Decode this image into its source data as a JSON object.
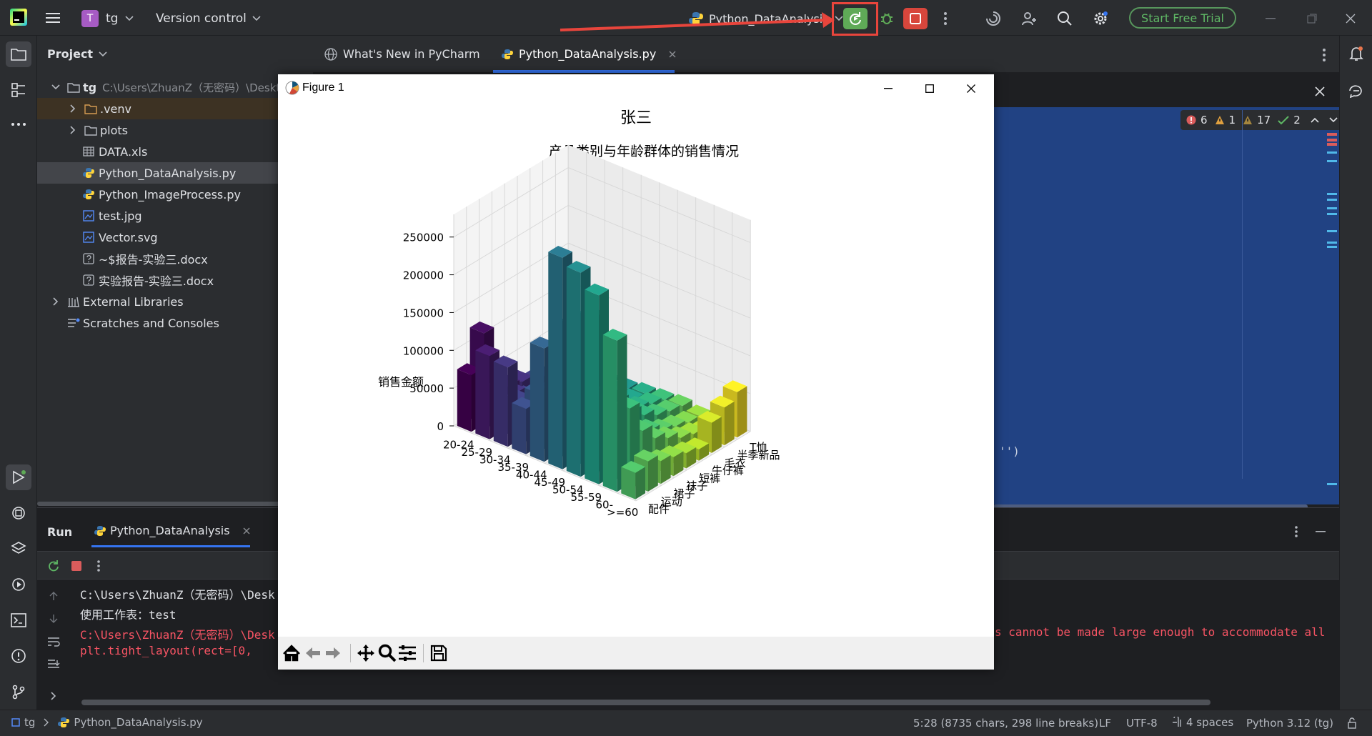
{
  "titlebar": {
    "project_badge": "T",
    "project_name": "tg",
    "vcs_label": "Version control",
    "run_config": "Python_DataAnalysis",
    "trial_button": "Start Free Trial"
  },
  "project_panel": {
    "title": "Project",
    "root_name": "tg",
    "root_path": "C:\\Users\\ZhuanZ（无密码）\\Deskto",
    "items": [
      {
        "label": ".venv",
        "icon": "folder-icon"
      },
      {
        "label": "plots",
        "icon": "folder-icon"
      },
      {
        "label": "DATA.xls",
        "icon": "table-file-icon"
      },
      {
        "label": "Python_DataAnalysis.py",
        "icon": "python-file-icon"
      },
      {
        "label": "Python_ImageProcess.py",
        "icon": "python-file-icon"
      },
      {
        "label": "test.jpg",
        "icon": "image-file-icon"
      },
      {
        "label": "Vector.svg",
        "icon": "image-file-icon"
      },
      {
        "label": "~$报告-实验三.docx",
        "icon": "unknown-file-icon"
      },
      {
        "label": "实验报告-实验三.docx",
        "icon": "unknown-file-icon"
      }
    ],
    "external_libraries": "External Libraries",
    "scratches": "Scratches and Consoles"
  },
  "editor": {
    "tabs": [
      {
        "label": "What's New in PyCharm"
      },
      {
        "label": "Python_DataAnalysis.py"
      }
    ],
    "inspections": {
      "errors": "6",
      "warnings": "1",
      "weak_warnings": "17",
      "typos": "2"
    },
    "code_fragment": "'')"
  },
  "run_panel": {
    "title": "Run",
    "tab_label": "Python_DataAnalysis",
    "lines": [
      "C:\\Users\\ZhuanZ（无密码）\\Desk",
      "使用工作表：test",
      "C:\\Users\\ZhuanZ（无密码）\\Desk",
      "  plt.tight_layout(rect=[0,"
    ],
    "warning_tail": "s cannot be made large enough to accommodate all"
  },
  "statusbar": {
    "breadcrumb_root": "tg",
    "breadcrumb_file": "Python_DataAnalysis.py",
    "position": "5:28 (8735 chars, 298 line breaks)",
    "line_ending": "LF",
    "encoding": "UTF-8",
    "indent": "4 spaces",
    "interpreter": "Python 3.12 (tg)"
  },
  "figure": {
    "window_title": "Figure 1"
  },
  "chart_data": {
    "type": "bar3d",
    "title": "张三",
    "subtitle": "产品类别与年龄群体的销售情况",
    "xlabel": "",
    "ylabel": "",
    "zlabel": "销售金额",
    "x_categories": [
      "20-24",
      "25-29",
      "30-34",
      "35-39",
      "40-44",
      "45-49",
      "50-54",
      "55-59",
      "60-",
      ">=60"
    ],
    "y_categories": [
      "配件",
      "运动",
      "裙子",
      "袜子",
      "短裤",
      "牛仔裤",
      "毛衣",
      "半季新品",
      "T恤"
    ],
    "z_ticks": [
      0,
      50000,
      100000,
      150000,
      200000,
      250000
    ],
    "zlim": [
      0,
      280000
    ],
    "colormap": "viridis",
    "values": [
      [
        75000,
        120000,
        60000,
        30000,
        25000,
        15000,
        10000,
        8000,
        5000
      ],
      [
        110000,
        55000,
        40000,
        25000,
        20000,
        12000,
        10000,
        6000,
        5000
      ],
      [
        105000,
        50000,
        35000,
        20000,
        15000,
        10000,
        8000,
        6000,
        4000
      ],
      [
        60000,
        70000,
        45000,
        30000,
        20000,
        15000,
        10000,
        8000,
        5000
      ],
      [
        150000,
        80000,
        60000,
        40000,
        25000,
        20000,
        15000,
        10000,
        8000
      ],
      [
        280000,
        180000,
        110000,
        60000,
        40000,
        30000,
        20000,
        15000,
        10000
      ],
      [
        270000,
        200000,
        120000,
        70000,
        45000,
        30000,
        20000,
        15000,
        12000
      ],
      [
        250000,
        110000,
        70000,
        40000,
        30000,
        20000,
        15000,
        10000,
        8000
      ],
      [
        200000,
        100000,
        60000,
        40000,
        30000,
        20000,
        15000,
        10000,
        8000
      ],
      [
        35000,
        40000,
        30000,
        25000,
        20000,
        15000,
        40000,
        50000,
        60000
      ]
    ]
  }
}
